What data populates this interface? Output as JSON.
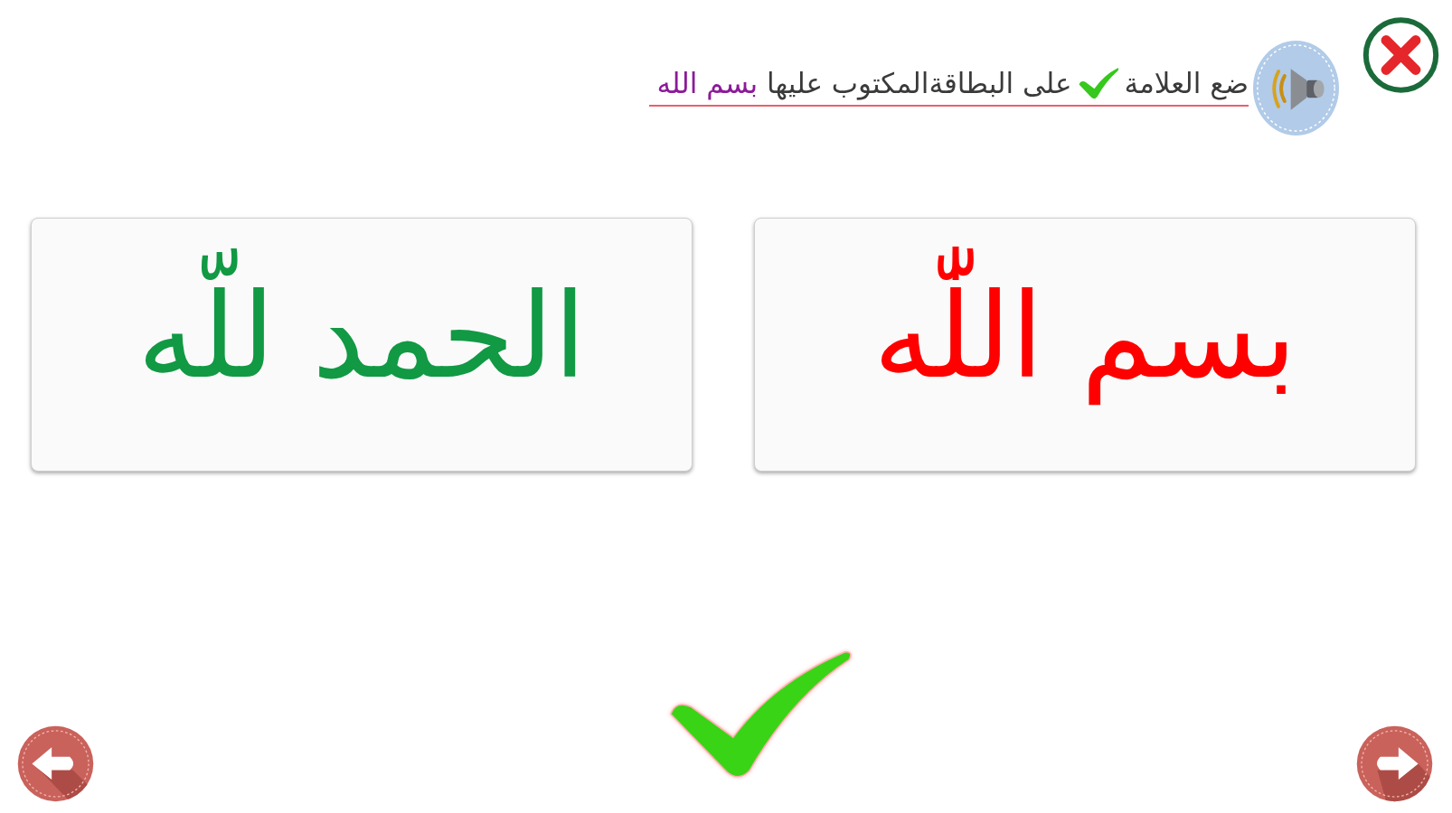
{
  "header": {
    "instruction": {
      "lead": "ضع العلامة",
      "rest": "على البطاقةالمكتوب عليها",
      "target": "بسم الله"
    }
  },
  "cards": [
    {
      "text": "بسم اللّٰه",
      "color": "#ff0000"
    },
    {
      "text": "الحمد للّه",
      "color": "#119944"
    }
  ],
  "correct": true
}
